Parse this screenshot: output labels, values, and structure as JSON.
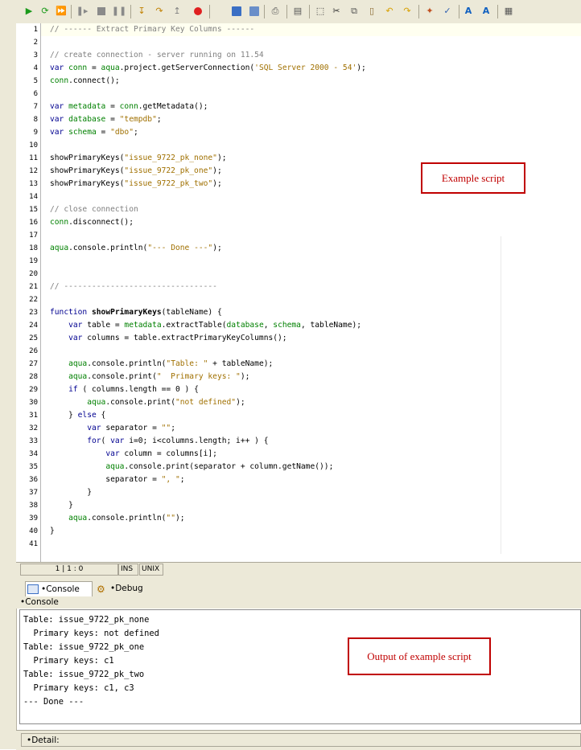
{
  "toolbar": {
    "icons": [
      "run-icon",
      "run-step-icon",
      "run-all-icon",
      "pause-icon",
      "stop-icon",
      "pause-all-icon",
      "step-into-icon",
      "step-over-icon",
      "step-out-icon",
      "breakpoint-icon",
      "save-icon",
      "save-all-icon",
      "print-icon",
      "page-icon",
      "select-icon",
      "cut-icon",
      "copy-icon",
      "paste-icon",
      "undo-icon",
      "redo-icon",
      "wand-icon",
      "check-icon",
      "find-icon",
      "replace-icon",
      "settings-icon"
    ]
  },
  "editor": {
    "lines": [
      "1",
      "2",
      "3",
      "4",
      "5",
      "6",
      "7",
      "8",
      "9",
      "10",
      "11",
      "12",
      "13",
      "14",
      "15",
      "16",
      "17",
      "18",
      "19",
      "20",
      "21",
      "22",
      "23",
      "24",
      "25",
      "26",
      "27",
      "28",
      "29",
      "30",
      "31",
      "32",
      "33",
      "34",
      "35",
      "36",
      "37",
      "38",
      "39",
      "40",
      "41"
    ],
    "code": {
      "l1": "// ------ Extract Primary Key Columns ------",
      "l3": "// create connection - server running on 11.54",
      "l4a": "var",
      "l4b": " ",
      "l4c": "conn",
      "l4d": " = ",
      "l4e": "aqua",
      "l4f": ".project.getServerConnection(",
      "l4g": "'SQL Server 2000 - 54'",
      "l4h": ");",
      "l5a": "conn",
      "l5b": ".connect();",
      "l7a": "var",
      "l7b": " ",
      "l7c": "metadata",
      "l7d": " = ",
      "l7e": "conn",
      "l7f": ".getMetadata();",
      "l8a": "var",
      "l8b": " ",
      "l8c": "database",
      "l8d": " = ",
      "l8e": "\"tempdb\"",
      "l8f": ";",
      "l9a": "var",
      "l9b": " ",
      "l9c": "schema",
      "l9d": " = ",
      "l9e": "\"dbo\"",
      "l9f": ";",
      "l11a": "showPrimaryKeys(",
      "l11b": "\"issue_9722_pk_none\"",
      "l11c": ");",
      "l12a": "showPrimaryKeys(",
      "l12b": "\"issue_9722_pk_one\"",
      "l12c": ");",
      "l13a": "showPrimaryKeys(",
      "l13b": "\"issue_9722_pk_two\"",
      "l13c": ");",
      "l15": "// close connection",
      "l16a": "conn",
      "l16b": ".disconnect();",
      "l18a": "aqua",
      "l18b": ".console.println(",
      "l18c": "\"--- Done ---\"",
      "l18d": ");",
      "l21": "// ---------------------------------",
      "l23a": "function",
      "l23b": " ",
      "l23c": "showPrimaryKeys",
      "l23d": "(tableName) {",
      "l24a": "    ",
      "l24b": "var",
      "l24c": " table = ",
      "l24d": "metadata",
      "l24e": ".extractTable(",
      "l24f": "database",
      "l24g": ", ",
      "l24h": "schema",
      "l24i": ", tableName);",
      "l25a": "    ",
      "l25b": "var",
      "l25c": " columns = table.extractPrimaryKeyColumns();",
      "l27a": "    ",
      "l27b": "aqua",
      "l27c": ".console.println(",
      "l27d": "\"Table: \"",
      "l27e": " + tableName);",
      "l28a": "    ",
      "l28b": "aqua",
      "l28c": ".console.print(",
      "l28d": "\"  Primary keys: \"",
      "l28e": ");",
      "l29a": "    ",
      "l29b": "if",
      "l29c": " ( columns.length == 0 ) {",
      "l30a": "        ",
      "l30b": "aqua",
      "l30c": ".console.print(",
      "l30d": "\"not defined\"",
      "l30e": ");",
      "l31a": "    } ",
      "l31b": "else",
      "l31c": " {",
      "l32a": "        ",
      "l32b": "var",
      "l32c": " separator = ",
      "l32d": "\"\"",
      "l32e": ";",
      "l33a": "        ",
      "l33b": "for",
      "l33c": "( ",
      "l33d": "var",
      "l33e": " i=0; i<columns.length; i++ ) {",
      "l34a": "            ",
      "l34b": "var",
      "l34c": " column = columns[i];",
      "l35a": "            ",
      "l35b": "aqua",
      "l35c": ".console.print(separator + column.getName());",
      "l36a": "            separator = ",
      "l36b": "\", \"",
      "l36c": ";",
      "l37": "        }",
      "l38": "    }",
      "l39a": "    ",
      "l39b": "aqua",
      "l39c": ".console.println(",
      "l39d": "\"\"",
      "l39e": ");",
      "l40": "}"
    }
  },
  "annotations": {
    "script": "Example script",
    "output": "Output of example script"
  },
  "status": {
    "position": "1 | 1 : 0",
    "mode": "INS",
    "lineending": "UNIX"
  },
  "tabs": {
    "console": "•Console",
    "debug": "•Debug"
  },
  "console": {
    "header": "•Console",
    "lines": [
      "Table: issue_9722_pk_none",
      "  Primary keys: not defined",
      "Table: issue_9722_pk_one",
      "  Primary keys: c1",
      "Table: issue_9722_pk_two",
      "  Primary keys: c1, c3",
      "--- Done ---"
    ]
  },
  "detail": {
    "label": "•Detail:"
  }
}
